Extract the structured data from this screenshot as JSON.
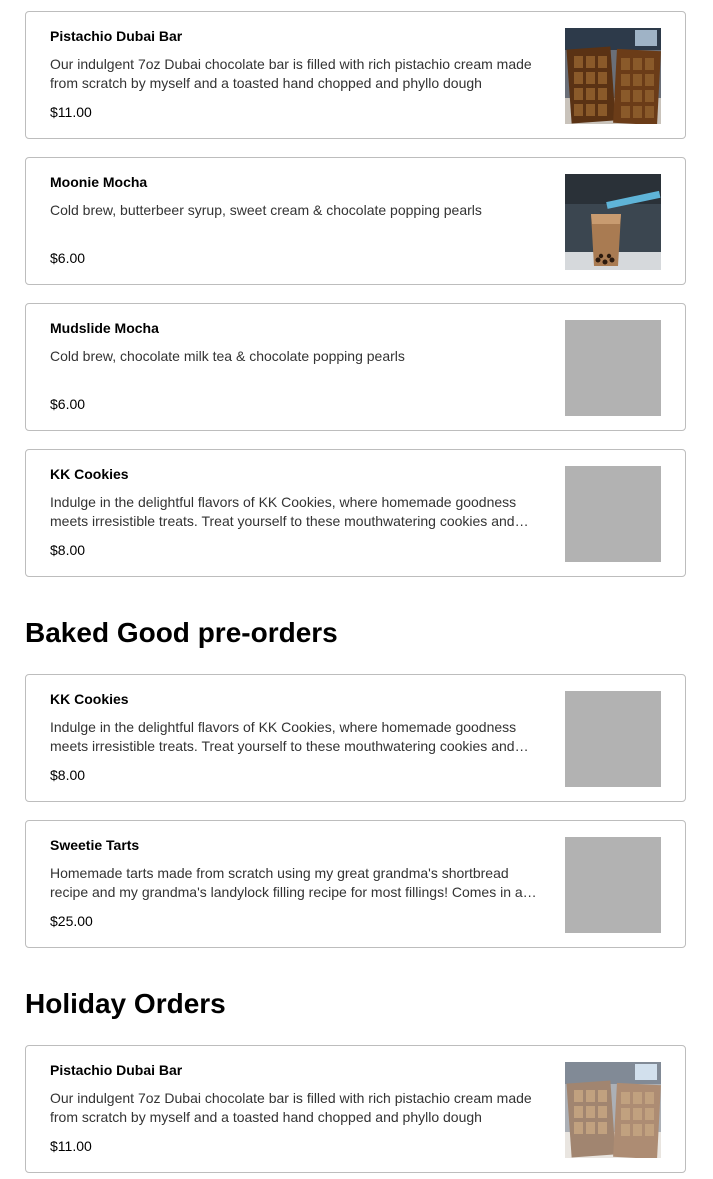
{
  "sections": [
    {
      "title": "",
      "items": [
        {
          "name": "Pistachio Dubai Bar",
          "desc": "Our indulgent 7oz Dubai chocolate bar is filled with rich pistachio cream made from scratch by myself and a toasted hand chopped and phyllo dough",
          "price": "$11.00",
          "image": "chocolate-bar-photo"
        },
        {
          "name": "Moonie Mocha",
          "desc": "Cold brew, butterbeer syrup, sweet cream & chocolate popping pearls",
          "price": "$6.00",
          "image": "iced-drink-photo"
        },
        {
          "name": "Mudslide Mocha",
          "desc": "Cold brew, chocolate milk tea & chocolate popping pearls",
          "price": "$6.00",
          "image": "placeholder"
        },
        {
          "name": "KK Cookies",
          "desc": "Indulge in the delightful flavors of KK Cookies, where homemade goodness meets irresistible treats. Treat yourself to these mouthwatering cookies and more",
          "price": "$8.00",
          "image": "placeholder"
        }
      ]
    },
    {
      "title": "Baked Good pre-orders",
      "items": [
        {
          "name": "KK Cookies",
          "desc": "Indulge in the delightful flavors of KK Cookies, where homemade goodness meets irresistible treats. Treat yourself to these mouthwatering cookies and more",
          "price": "$8.00",
          "image": "placeholder"
        },
        {
          "name": "Sweetie Tarts",
          "desc": "Homemade tarts made from scratch using my great grandma's shortbread recipe and my grandma's landylock filling recipe for most fillings! Comes in a box",
          "price": "$25.00",
          "image": "placeholder"
        }
      ]
    },
    {
      "title": "Holiday Orders",
      "items": [
        {
          "name": "Pistachio Dubai Bar",
          "desc": "Our indulgent 7oz Dubai chocolate bar is filled with rich pistachio cream made from scratch by myself and a toasted hand chopped and phyllo dough",
          "price": "$11.00",
          "image": "chocolate-bar-photo"
        }
      ]
    }
  ]
}
